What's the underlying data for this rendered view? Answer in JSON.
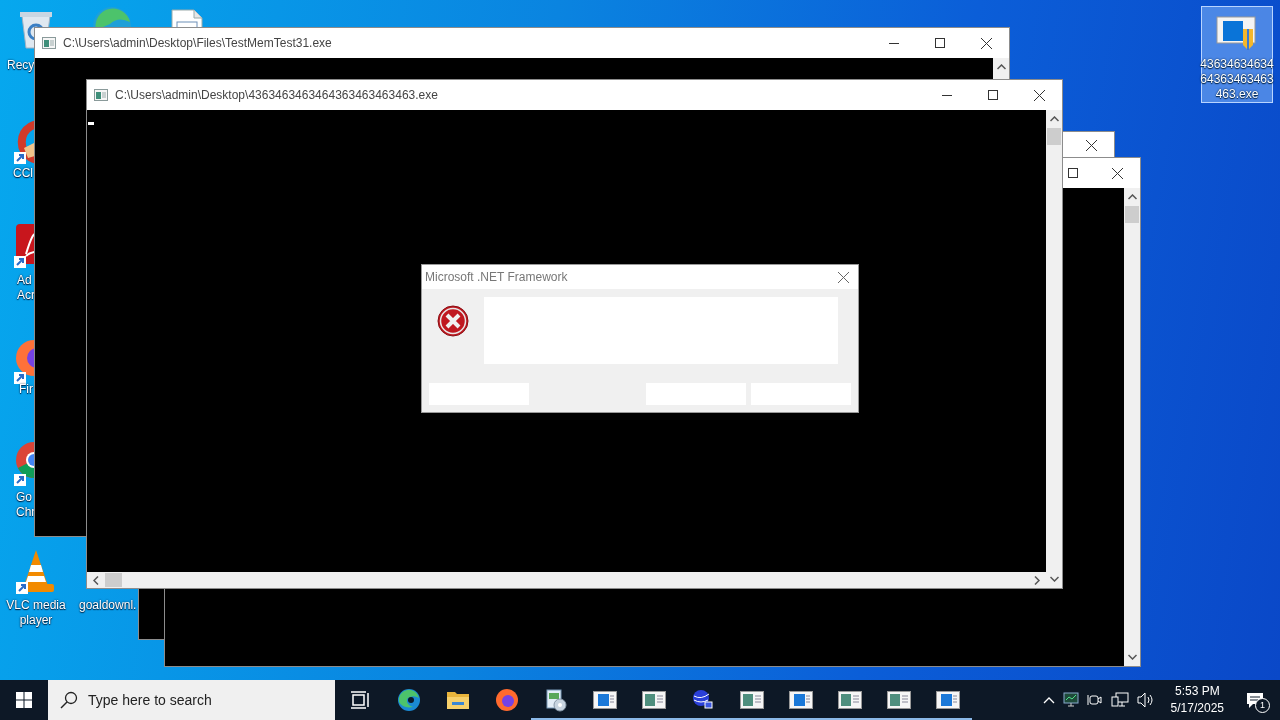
{
  "desktop": {
    "icons": [
      {
        "kind": "recycle-bin",
        "lines": [
          "Recy"
        ],
        "selected": false
      },
      {
        "kind": "edge",
        "selected": false
      },
      {
        "kind": "text-file",
        "selected": false
      },
      {
        "kind": "ccleaner",
        "lines": [
          "CCl"
        ],
        "selected": false
      },
      {
        "kind": "acrobat",
        "lines": [
          "Ad",
          "Acr"
        ],
        "selected": false
      },
      {
        "kind": "firefox",
        "lines": [
          "Fir"
        ],
        "selected": false
      },
      {
        "kind": "chrome",
        "lines": [
          "Go",
          "Chr"
        ],
        "selected": false
      },
      {
        "kind": "vlc",
        "lines": [
          "VLC media",
          "player"
        ],
        "selected": false
      },
      {
        "lines": [
          "goaldownl."
        ],
        "selected": false
      },
      {
        "kind": "exe-app",
        "lines": [
          "43634634634",
          "64363463463",
          "463.exe"
        ],
        "selected": true
      }
    ]
  },
  "windows": [
    {
      "title": "C:\\Users\\admin\\Desktop\\Files\\TestMemTest31.exe",
      "controls": [
        {
          "kind": "minimize"
        },
        {
          "kind": "maximize"
        },
        {
          "kind": "close"
        }
      ]
    },
    {
      "title": "C:\\Users\\admin\\Desktop\\4363463463464363463463463.exe",
      "controls": [
        {
          "kind": "minimize"
        },
        {
          "kind": "maximize"
        },
        {
          "kind": "close"
        }
      ]
    },
    {
      "controls": [
        {
          "kind": "close"
        }
      ]
    },
    {
      "controls": [
        {
          "kind": "maximize"
        },
        {
          "kind": "close"
        }
      ]
    }
  ],
  "dialog": {
    "title": "Microsoft .NET Framework"
  },
  "taskbar": {
    "search": {
      "placeholder": "Type here to search"
    },
    "apps": [
      {
        "kind": "task-view",
        "running": false
      },
      {
        "kind": "edge",
        "running": false
      },
      {
        "kind": "explorer",
        "running": false
      },
      {
        "kind": "firefox",
        "running": false
      },
      {
        "kind": "installer",
        "running": true
      },
      {
        "kind": "console-blue",
        "running": true
      },
      {
        "kind": "console-green",
        "running": true
      },
      {
        "kind": "globe-app",
        "running": true
      },
      {
        "kind": "console-green",
        "running": true
      },
      {
        "kind": "console-blue",
        "running": true
      },
      {
        "kind": "console-green",
        "running": true
      },
      {
        "kind": "console-green",
        "running": true
      },
      {
        "kind": "console-blue",
        "running": true
      }
    ],
    "clock": {
      "time": "5:53 PM",
      "date": "5/17/2025"
    },
    "notifications": {
      "count": "1"
    }
  }
}
